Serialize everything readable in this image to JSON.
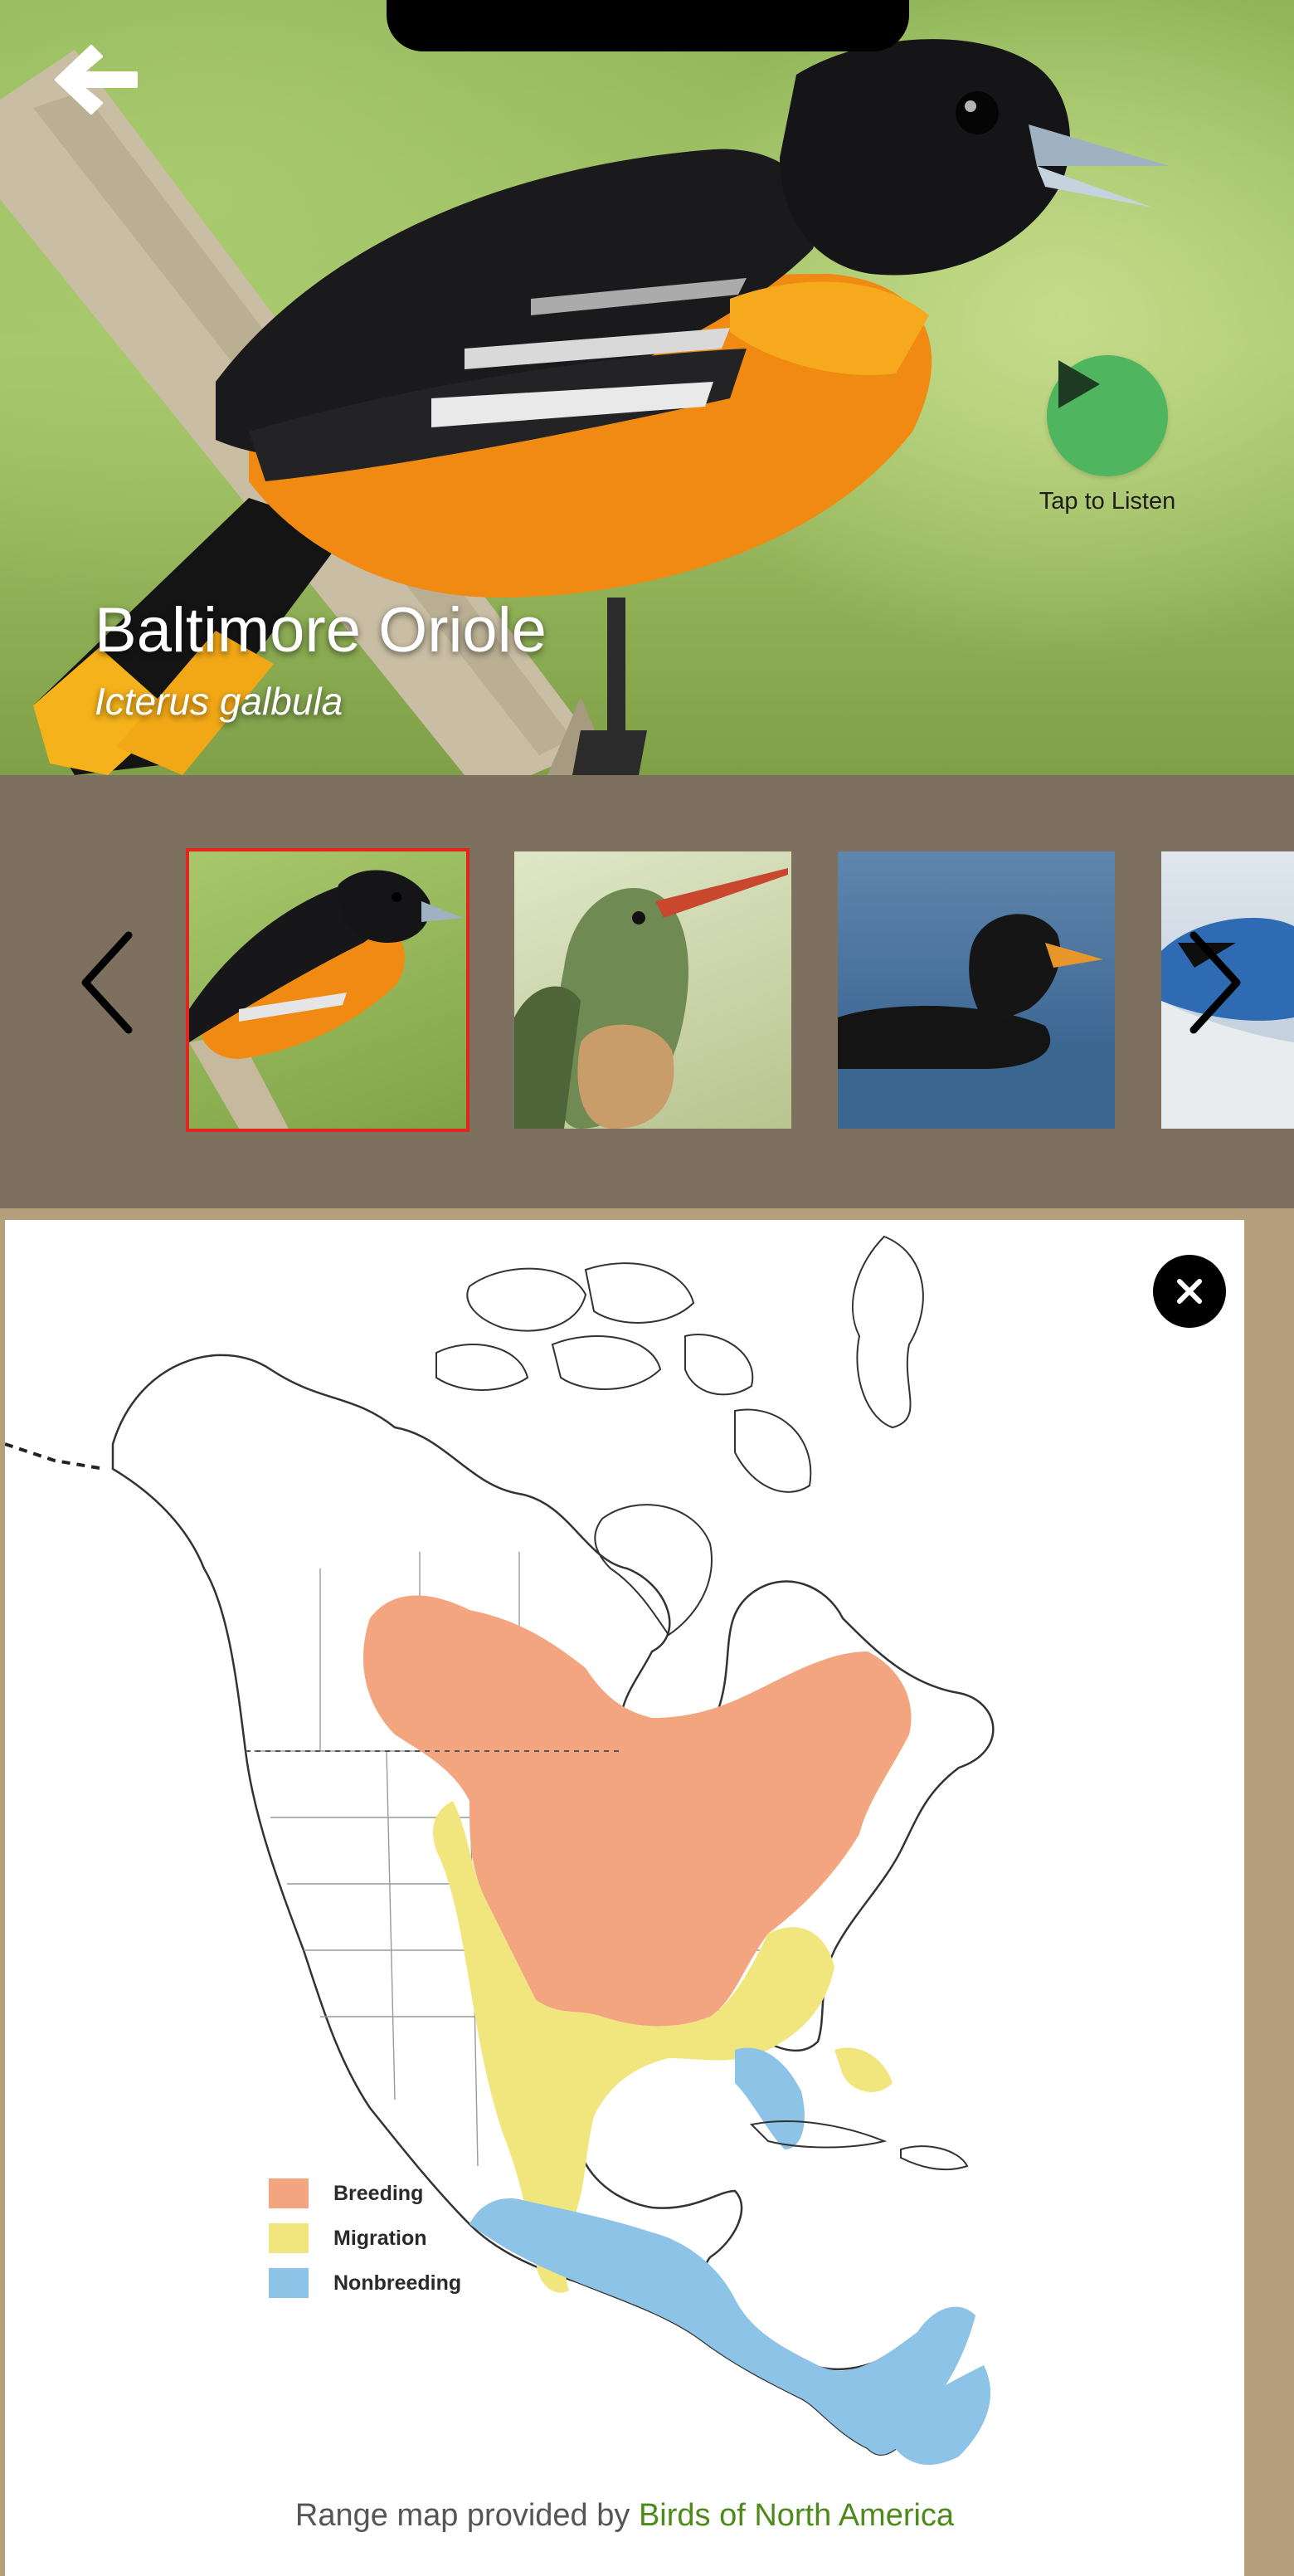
{
  "header": {
    "bird_name": "Baltimore Oriole",
    "scientific_name": "Icterus galbula",
    "listen_label": "Tap to Listen"
  },
  "icons": {
    "back": "arrow-left-icon",
    "play": "play-icon",
    "prev": "chevron-left-icon",
    "next": "chevron-right-icon",
    "close": "close-icon"
  },
  "carousel": {
    "selected_index": 0,
    "thumbnails": [
      {
        "subject": "Baltimore Oriole"
      },
      {
        "subject": "Hummingbird"
      },
      {
        "subject": "Scoter duck"
      },
      {
        "subject": "Blue Jay"
      }
    ]
  },
  "range_map": {
    "legend": [
      {
        "label": "Breeding",
        "color": "#f2a57f"
      },
      {
        "label": "Migration",
        "color": "#f1e57d"
      },
      {
        "label": "Nonbreeding",
        "color": "#8cc3e6"
      }
    ],
    "credit_prefix": "Range map provided by ",
    "credit_link": "Birds of North America"
  },
  "colors": {
    "play_button": "#4fb55f",
    "carousel_bg": "#7d705f",
    "map_border": "#b49e7c",
    "selected_outline": "#e0261f",
    "link": "#4d8a1a"
  }
}
